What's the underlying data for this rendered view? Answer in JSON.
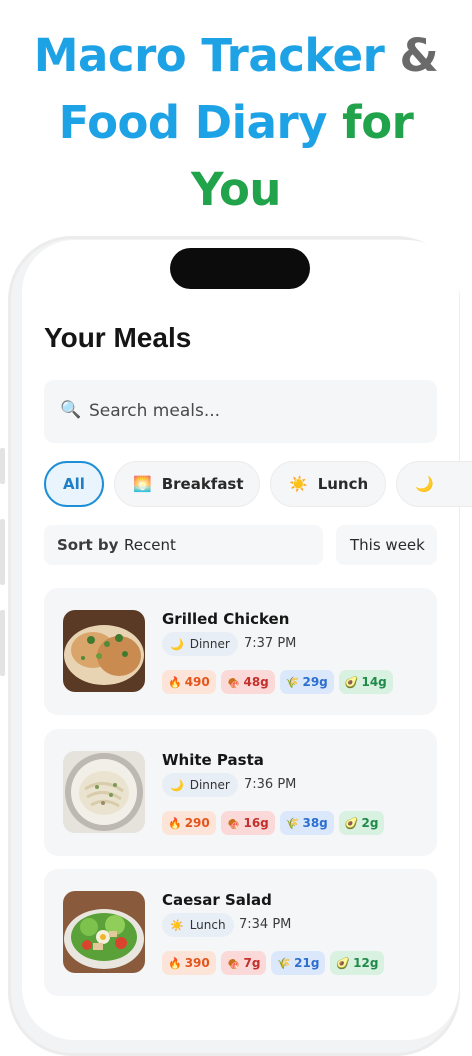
{
  "headline": {
    "line1_part1": "Macro Tracker",
    "line1_part2": "&",
    "line2_part1": "Food Diary",
    "line2_part2": "for",
    "line3": "You"
  },
  "page_title": "Your Meals",
  "search": {
    "placeholder": "Search meals...",
    "icon": "search-icon"
  },
  "filters": [
    {
      "label": "All",
      "icon": "",
      "active": true
    },
    {
      "label": "Breakfast",
      "icon": "sunrise-icon",
      "active": false
    },
    {
      "label": "Lunch",
      "icon": "sun-icon",
      "active": false
    },
    {
      "label": "",
      "icon": "moon-icon",
      "active": false
    }
  ],
  "sort": {
    "label": "Sort by",
    "value": "Recent",
    "range": "This week"
  },
  "meals": [
    {
      "name": "Grilled Chicken",
      "tag": "Dinner",
      "tag_icon": "moon-icon",
      "time": "7:37 PM",
      "calories": "490",
      "protein": "48g",
      "carbs": "29g",
      "fat": "14g"
    },
    {
      "name": "White Pasta",
      "tag": "Dinner",
      "tag_icon": "moon-icon",
      "time": "7:36 PM",
      "calories": "290",
      "protein": "16g",
      "carbs": "38g",
      "fat": "2g"
    },
    {
      "name": "Caesar Salad",
      "tag": "Lunch",
      "tag_icon": "sun-icon",
      "time": "7:34 PM",
      "calories": "390",
      "protein": "7g",
      "carbs": "21g",
      "fat": "12g"
    }
  ],
  "colors": {
    "accent": "#1ea2e6",
    "green": "#20a34a"
  }
}
